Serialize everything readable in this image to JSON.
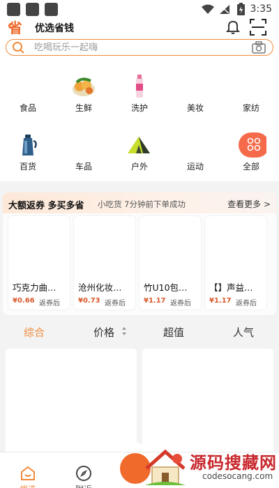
{
  "status_bar": {
    "time": "3:35"
  },
  "app_bar": {
    "title": "优选省钱",
    "logo_icon": "logo-icon",
    "bell_icon": "bell-icon",
    "scan_icon": "scan-icon"
  },
  "search": {
    "placeholder": "吃喝玩乐一起嗨",
    "accent": "#f08a3a"
  },
  "categories": [
    {
      "label": "食品",
      "icon": "none"
    },
    {
      "label": "生鲜",
      "icon": "fruit-icon"
    },
    {
      "label": "洗护",
      "icon": "bottle-icon"
    },
    {
      "label": "美妆",
      "icon": "none"
    },
    {
      "label": "家纺",
      "icon": "none"
    },
    {
      "label": "百货",
      "icon": "kettle-icon"
    },
    {
      "label": "车品",
      "icon": "none"
    },
    {
      "label": "户外",
      "icon": "tent-icon"
    },
    {
      "label": "运动",
      "icon": "none"
    },
    {
      "label": "全部",
      "icon": "grid-all-icon"
    }
  ],
  "promo": {
    "title": "大额返券 多买多省",
    "subtitle": "小吃货 7分钟前下单成功",
    "more": "查看更多 >",
    "items": [
      {
        "name": "巧克力曲…",
        "price": "¥0.66",
        "suffix": "返券后"
      },
      {
        "name": "沧州化妆…",
        "price": "¥0.73",
        "suffix": "返券后"
      },
      {
        "name": "竹U10包…",
        "price": "¥1.17",
        "suffix": "返券后"
      },
      {
        "name": "【】声益…",
        "price": "¥1.17",
        "suffix": "返券后"
      }
    ]
  },
  "sort_tabs": [
    "综合",
    "价格",
    "超值",
    "人气"
  ],
  "bottom_tabs": [
    "优选",
    "附近"
  ],
  "watermark": {
    "text": "源码搜藏网",
    "url": "codesocang.com"
  }
}
